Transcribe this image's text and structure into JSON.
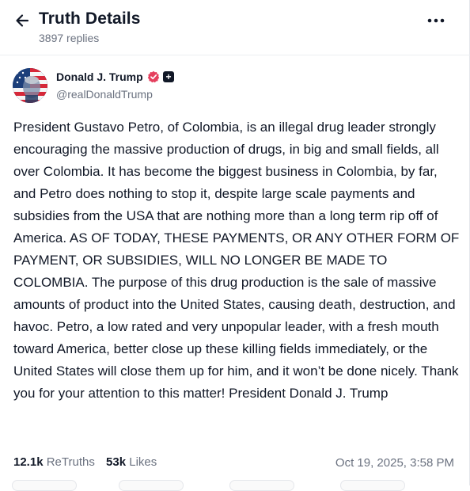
{
  "header": {
    "title": "Truth Details",
    "replies": "3897 replies",
    "back_icon": "arrow-left-icon",
    "more_icon": "more-horizontal-icon"
  },
  "author": {
    "display_name": "Donald J. Trump",
    "handle": "@realDonaldTrump",
    "verified_color": "#e5405e",
    "badge": "+"
  },
  "post": {
    "text": "President Gustavo Petro, of Colombia, is an illegal drug leader strongly encouraging the massive production of drugs, in big and small fields, all over Colombia. It has become the biggest business in Colombia, by far, and Petro does nothing to stop it, despite large scale payments and subsidies from the USA that are nothing more than a long term rip off of America. AS OF TODAY, THESE PAYMENTS, OR ANY OTHER FORM OF PAYMENT, OR SUBSIDIES, WILL NO LONGER BE MADE TO COLOMBIA. The purpose of this drug production is the sale of massive amounts of product into the United States, causing death, destruction, and havoc. Petro, a low rated and very unpopular leader, with a fresh mouth toward America, better close up these killing fields immediately, or the United States will close them up for him, and it won’t be done nicely. Thank you for your attention to this matter! President Donald J. Trump"
  },
  "stats": {
    "retruths_count": "12.1k",
    "retruths_label": "ReTruths",
    "likes_count": "53k",
    "likes_label": "Likes",
    "timestamp": "Oct 19, 2025, 3:58 PM"
  }
}
